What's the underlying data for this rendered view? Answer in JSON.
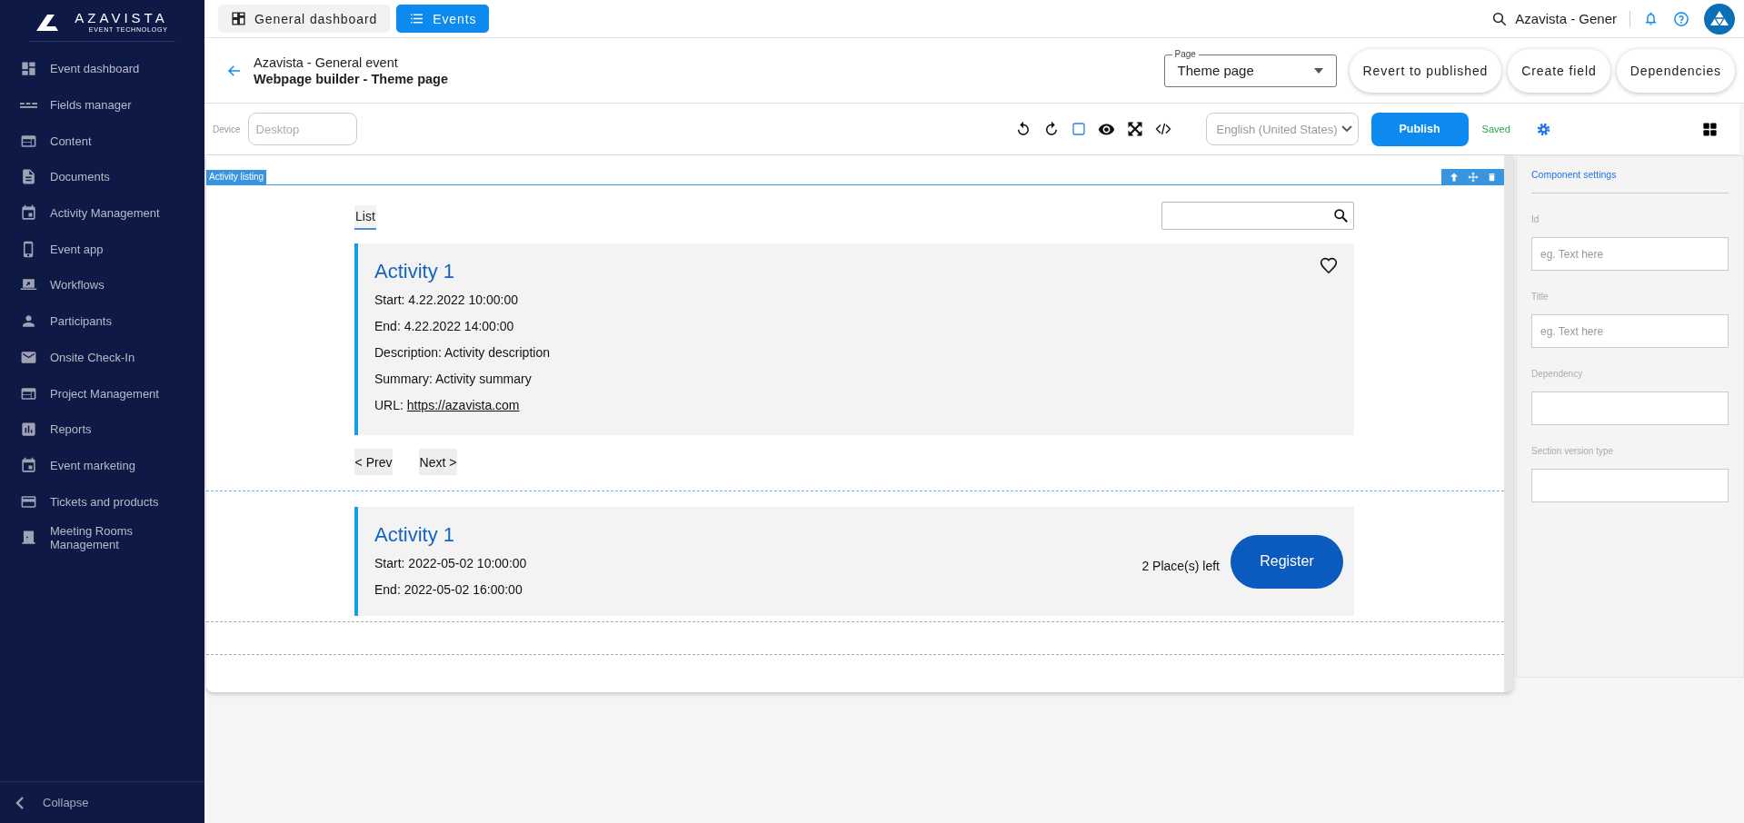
{
  "sidebar": {
    "logo": {
      "name": "AZAVISTA",
      "tagline": "EVENT TECHNOLOGY"
    },
    "items": [
      {
        "label": "Event dashboard",
        "selected": false
      },
      {
        "label": "Fields manager",
        "selected": false
      },
      {
        "label": "Content",
        "selected": false
      },
      {
        "label": "Documents",
        "selected": false
      },
      {
        "label": "Activity Management",
        "selected": false
      },
      {
        "label": "Event app",
        "selected": false
      },
      {
        "label": "Workflows",
        "selected": false
      },
      {
        "label": "Participants",
        "selected": false
      },
      {
        "label": "Onsite Check-In",
        "selected": false
      },
      {
        "label": "Project Management",
        "selected": false
      },
      {
        "label": "Reports",
        "selected": false
      },
      {
        "label": "Event marketing",
        "selected": false
      },
      {
        "label": "Tickets and products",
        "selected": false
      },
      {
        "label": "Meeting Rooms Management",
        "selected": false
      }
    ],
    "collapse": "Collapse"
  },
  "topbar": {
    "tabs": [
      {
        "label": "General dashboard",
        "selected": false
      },
      {
        "label": "Events",
        "selected": true
      }
    ],
    "search_text": "Azavista - Gener"
  },
  "header": {
    "event_name": "Azavista - General event",
    "page_title": "Webpage builder - Theme page",
    "page_select": {
      "label": "Page",
      "value": "Theme page"
    },
    "actions": [
      "Revert to published",
      "Create field",
      "Dependencies"
    ]
  },
  "toolbar": {
    "device": {
      "label": "Device",
      "placeholder": "Desktop"
    },
    "language": {
      "value": "English (United States)",
      "disabled": true
    },
    "publish": "Publish",
    "status": "Saved"
  },
  "canvas": {
    "section_label": "Activity listing",
    "list_tabs": [
      {
        "label": "List",
        "selected": true
      }
    ],
    "activities": [
      {
        "title": "Activity 1",
        "favorite": false,
        "lines": [
          {
            "kind": "text",
            "text": "Start: 4.22.2022 10:00:00"
          },
          {
            "kind": "text",
            "text": "End: 4.22.2022 14:00:00"
          },
          {
            "kind": "text",
            "text": "Description: Activity description"
          },
          {
            "kind": "text",
            "text": "Summary: Activity summary"
          },
          {
            "kind": "link",
            "label": "URL:",
            "url": "https://azavista.com"
          }
        ]
      }
    ],
    "pagination": [
      "< Prev",
      "Next >"
    ],
    "registration": {
      "title": "Activity 1",
      "lines": [
        "Start: 2022-05-02 10:00:00",
        "End: 2022-05-02 16:00:00"
      ],
      "places": "2 Place(s) left",
      "button": "Register"
    }
  },
  "panel": {
    "tabs": [
      {
        "label": "Component settings",
        "selected": true
      }
    ],
    "fields": [
      {
        "label": "Id",
        "placeholder": "eg. Text here"
      },
      {
        "label": "Title",
        "placeholder": "eg. Text here"
      },
      {
        "label": "Dependency"
      },
      {
        "label": "Section version type"
      }
    ]
  }
}
